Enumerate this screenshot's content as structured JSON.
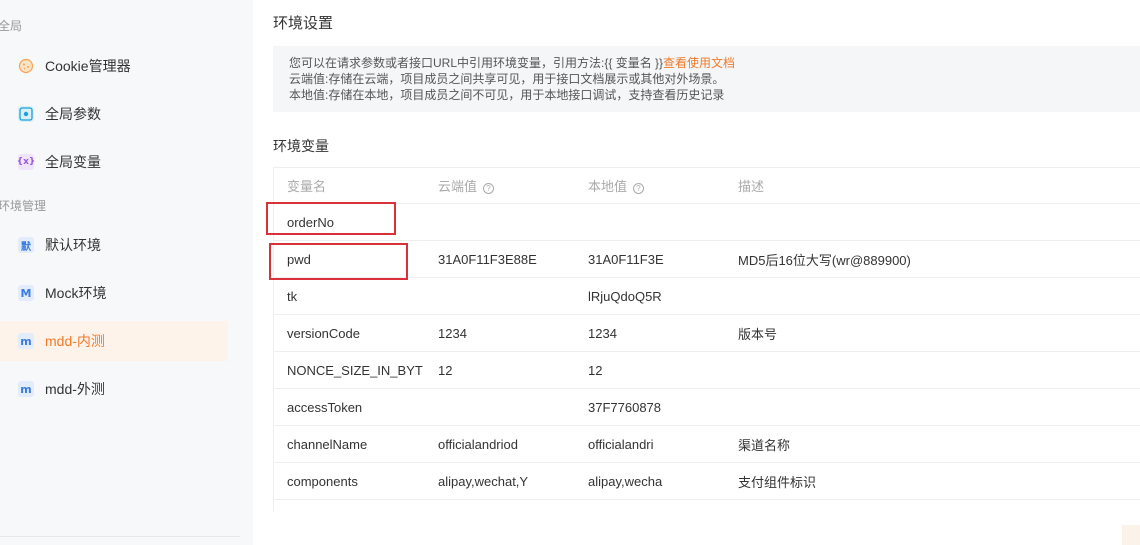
{
  "sidebar": {
    "section_global": "全局",
    "section_env": "环境管理",
    "global_items": [
      {
        "label": "Cookie管理器",
        "icon": "cookie-icon"
      },
      {
        "label": "全局参数",
        "icon": "param-icon"
      },
      {
        "label": "全局变量",
        "icon": "variable-icon"
      }
    ],
    "env_items": [
      {
        "label": "默认环境",
        "icon_text": "默"
      },
      {
        "label": "Mock环境",
        "icon_text": "M"
      },
      {
        "label": "mdd-内测",
        "icon_text": "m",
        "active": true
      },
      {
        "label": "mdd-外测",
        "icon_text": "m"
      }
    ],
    "var_icon_text": "{x}"
  },
  "main": {
    "title": "环境设置",
    "notice": {
      "line1": "您可以在请求参数或者接口URL中引用环境变量，引用方法:{{ 变量名 }}",
      "line1_link": "查看使用文档",
      "line2": "云端值:存储在云端，项目成员之间共享可见，用于接口文档展示或其他对外场景。",
      "line3": "本地值:存储在本地，项目成员之间不可见，用于本地接口调试，支持查看历史记录"
    },
    "section_title": "环境变量",
    "table": {
      "headers": [
        "变量名",
        "云端值",
        "本地值",
        "描述"
      ],
      "help_glyph": "?",
      "rows": [
        [
          "orderNo",
          "",
          "",
          ""
        ],
        [
          "pwd",
          "31A0F11F3E88E",
          "31A0F11F3E",
          "MD5后16位大写(wr@889900)"
        ],
        [
          "tk",
          "",
          "lRjuQdoQ5R",
          ""
        ],
        [
          "versionCode",
          "1234",
          "1234",
          "版本号"
        ],
        [
          "NONCE_SIZE_IN_BYT",
          "12",
          "12",
          ""
        ],
        [
          "accessToken",
          "",
          "37F7760878",
          ""
        ],
        [
          "channelName",
          "officialandriod",
          "officialandri",
          "渠道名称"
        ],
        [
          "components",
          "alipay,wechat,Y",
          "alipay,wecha",
          "支付组件标识"
        ]
      ]
    }
  },
  "colors": {
    "accent": "#f07b29",
    "highlight_box": "#d9303a"
  }
}
